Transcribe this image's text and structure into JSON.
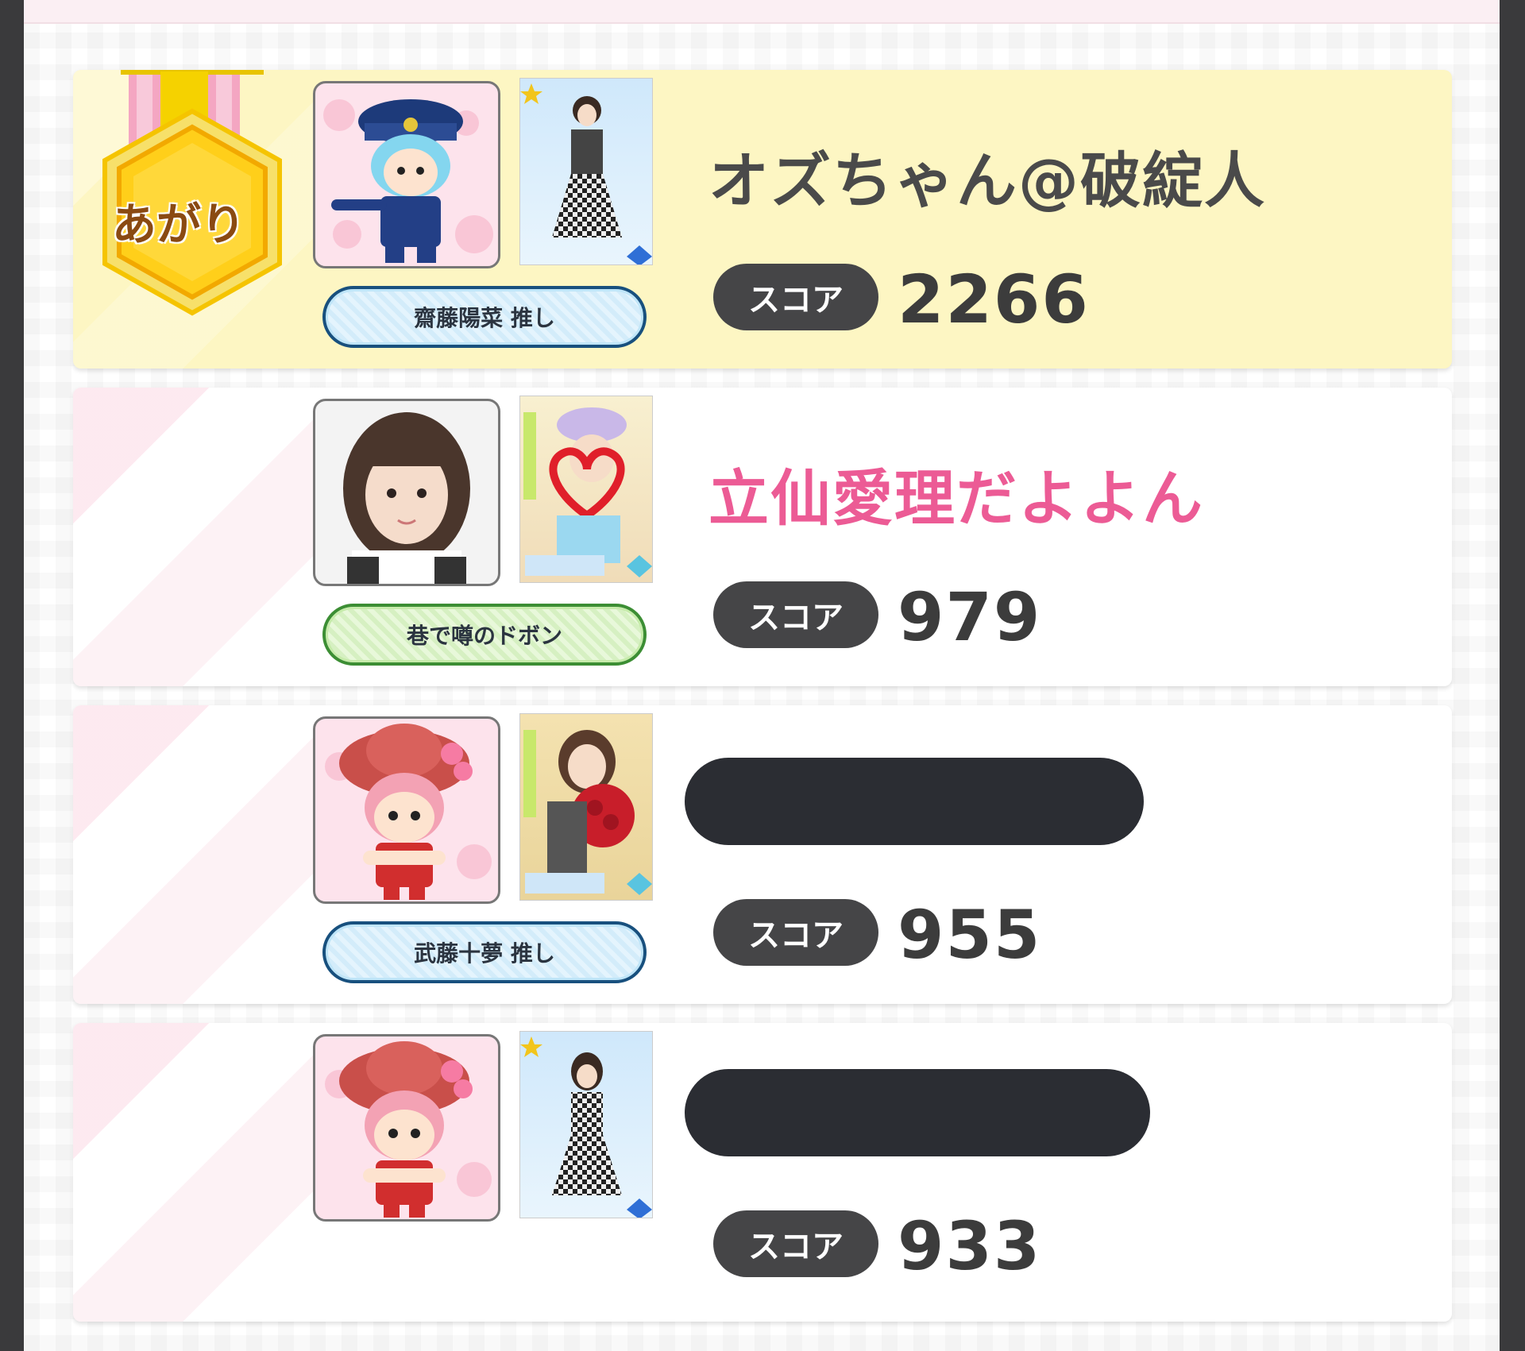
{
  "medal": {
    "label": "あがり"
  },
  "score_label": "スコア",
  "rows": [
    {
      "name": "オズちゃん@破綻人",
      "name_color": "#4a4a4a",
      "score": "2266",
      "oshi": "齋藤陽菜 推し",
      "oshi_style": "blue",
      "avatar": "blue-police-character",
      "card": "idol-card-n",
      "redacted": false
    },
    {
      "name": "立仙愛理だよよん",
      "name_color": "#ec5b95",
      "score": "979",
      "oshi": "巷で噂のドボン",
      "oshi_style": "green",
      "avatar": "photo-portrait",
      "card": "idol-card-heart",
      "redacted": false
    },
    {
      "name": "",
      "score": "955",
      "oshi": "武藤十夢 推し",
      "oshi_style": "blue",
      "avatar": "pink-hat-character",
      "card": "idol-card-red-flowers",
      "redacted": true
    },
    {
      "name": "",
      "score": "933",
      "oshi": "",
      "avatar": "pink-hat-character",
      "card": "idol-card-n",
      "redacted": true
    }
  ]
}
